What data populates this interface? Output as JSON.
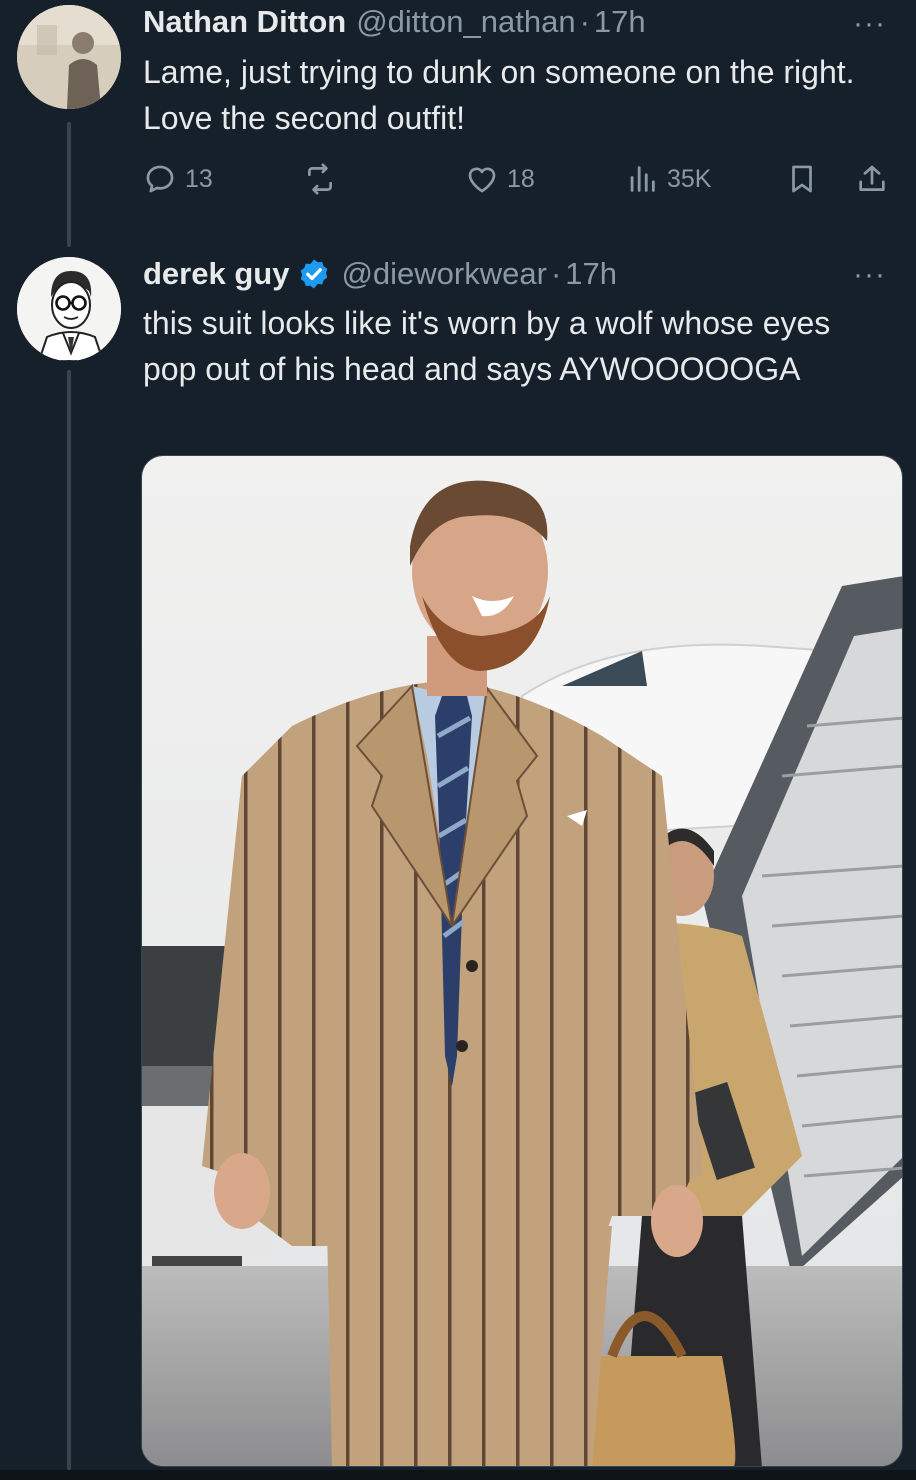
{
  "replies": [
    {
      "author_name": "Nathan Ditton",
      "handle": "@ditton_nathan",
      "separator": "·",
      "time": "17h",
      "text": "Lame, just trying to dunk on someone on the right. Love the second outfit!",
      "more_label": "···",
      "actions": {
        "reply_count": "13",
        "retweet_count": "",
        "like_count": "18",
        "views_count": "35K"
      },
      "icons": [
        "reply-icon",
        "retweet-icon",
        "like-icon",
        "views-icon",
        "bookmark-icon",
        "share-icon"
      ]
    },
    {
      "author_name": "derek guy",
      "verified": true,
      "handle": "@dieworkwear",
      "separator": "·",
      "time": "17h",
      "text": "this suit looks like it's worn by a wolf whose eyes pop out of his head and says AYWOOOOOGA",
      "more_label": "···",
      "media": "photo"
    }
  ],
  "colors": {
    "background": "#15202b",
    "text": "#e7e9ea",
    "secondary": "#8b98a5",
    "verified": "#1d9bf0",
    "thread_line": "#38444d"
  }
}
